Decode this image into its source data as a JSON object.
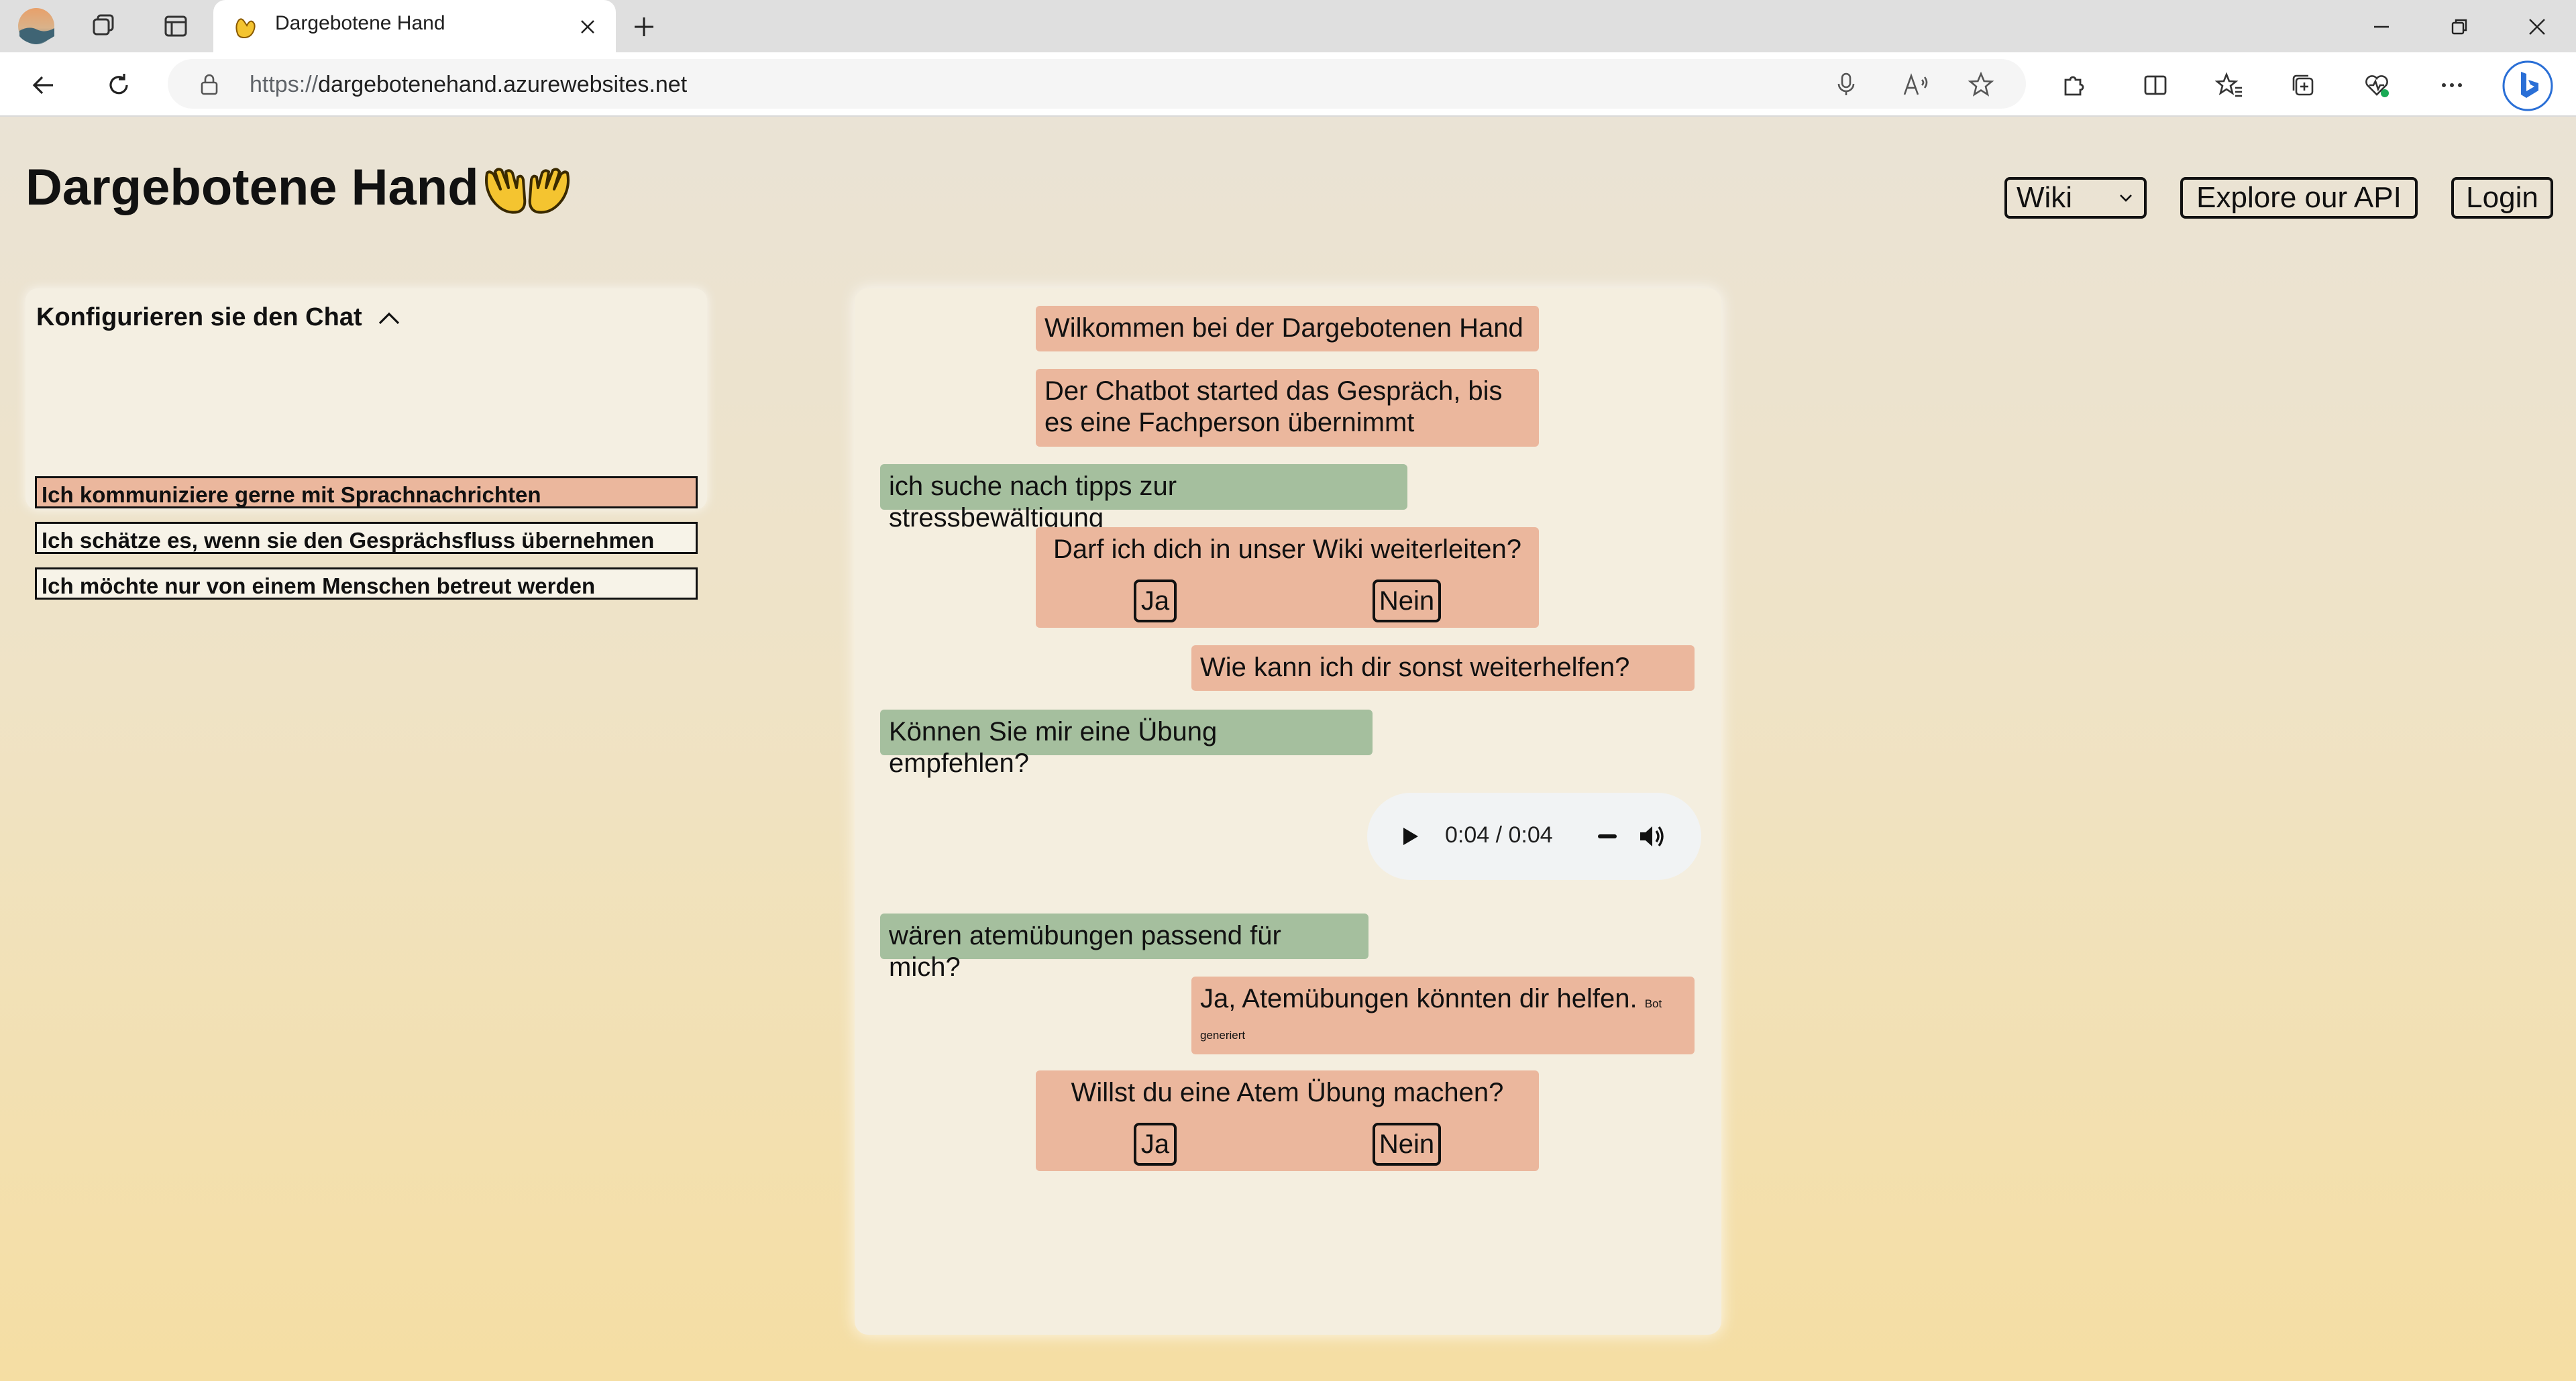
{
  "browser": {
    "tab_title": "Dargebotene Hand",
    "url_protocol": "https://",
    "url_host": "dargebotenehand.azurewebsites.net"
  },
  "header": {
    "site_title": "Dargebotene Hand",
    "logo_icon": "hands-icon",
    "wiki_select_value": "Wiki",
    "api_button": "Explore our API",
    "login_button": "Login"
  },
  "config": {
    "title": "Konfigurieren sie den Chat",
    "options": [
      {
        "label": "Ich kommuniziere gerne mit Sprachnachrichten",
        "active": true
      },
      {
        "label": "Ich schätze es, wenn sie den Gesprächsfluss übernehmen",
        "active": false
      },
      {
        "label": "Ich möchte nur von einem Menschen betreut werden",
        "active": false
      }
    ]
  },
  "chat": {
    "messages": [
      {
        "role": "bot",
        "text": "Wilkommen bei der Dargebotenen Hand"
      },
      {
        "role": "bot",
        "text": "Der Chatbot started das Gespräch, bis es eine Fachperson übernimmt"
      },
      {
        "role": "user",
        "text": "ich suche nach tipps zur stressbewältigung"
      },
      {
        "role": "bot",
        "text": "Darf ich dich in unser Wiki weiterleiten?",
        "yes": "Ja",
        "no": "Nein"
      },
      {
        "role": "bot",
        "text": "Wie kann ich dir sonst weiterhelfen?"
      },
      {
        "role": "user",
        "text": "Können Sie mir eine Übung empfehlen?"
      },
      {
        "role": "bot-audio",
        "time": "0:04 / 0:04"
      },
      {
        "role": "user",
        "text": "wären atemübungen passend für mich?"
      },
      {
        "role": "bot",
        "text": "Ja, Atemübungen könnten dir helfen.",
        "note": "Bot generiert"
      },
      {
        "role": "bot",
        "text": "Willst du eine Atem Übung machen?",
        "yes": "Ja",
        "no": "Nein"
      }
    ]
  },
  "colors": {
    "bot_bubble": "#ebb79d",
    "user_bubble": "#a5bf9e",
    "panel": "#f4eedf"
  }
}
